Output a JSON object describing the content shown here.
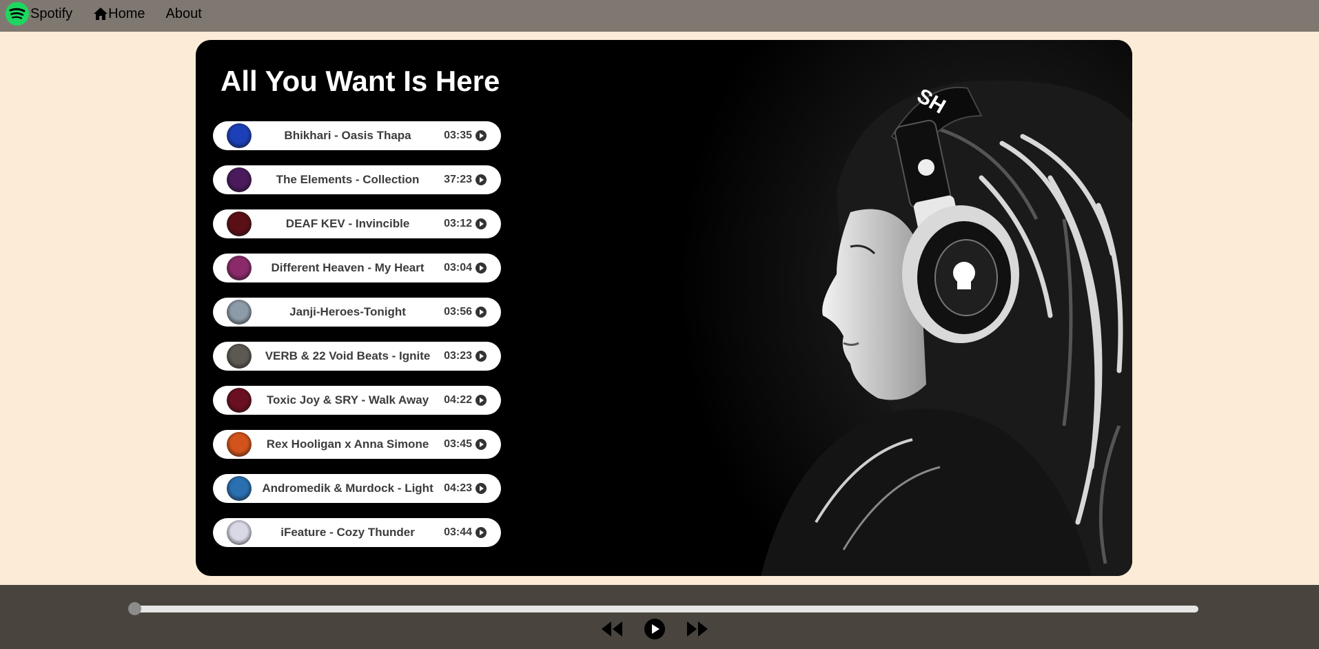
{
  "nav": {
    "brand": "Spotify",
    "home": "Home",
    "about": "About",
    "logo_icon": "spotify-logo-icon",
    "home_icon": "home-icon"
  },
  "hero": {
    "title": "All You Want Is Here",
    "image": "woman-with-headphones-photo"
  },
  "songs": [
    {
      "name": "Bhikhari - Oasis Thapa",
      "duration": "03:35",
      "cover": "#1d3fb8"
    },
    {
      "name": "The Elements - Collection",
      "duration": "37:23",
      "cover": "#4a1a5c"
    },
    {
      "name": "DEAF KEV - Invincible",
      "duration": "03:12",
      "cover": "#5a0f14"
    },
    {
      "name": "Different Heaven - My Heart",
      "duration": "03:04",
      "cover": "#8a2a6a"
    },
    {
      "name": "Janji-Heroes-Tonight",
      "duration": "03:56",
      "cover": "#8d9aa8"
    },
    {
      "name": "VERB & 22 Void Beats - Ignite",
      "duration": "03:23",
      "cover": "#5c5852"
    },
    {
      "name": "Toxic Joy & SRY - Walk Away",
      "duration": "04:22",
      "cover": "#6a1020"
    },
    {
      "name": "Rex Hooligan x Anna Simone",
      "duration": "03:45",
      "cover": "#d2531b"
    },
    {
      "name": "Andromedik & Murdock - Light",
      "duration": "04:23",
      "cover": "#2a6fb0"
    },
    {
      "name": "iFeature - Cozy Thunder",
      "duration": "03:44",
      "cover": "#d8d8e6"
    }
  ],
  "player": {
    "progress": 0,
    "prev_icon": "backward-icon",
    "play_icon": "play-circle-icon",
    "next_icon": "forward-icon"
  },
  "colors": {
    "nav_bg": "#7f7870",
    "page_bg": "#fbebd7",
    "player_bg": "#49443e",
    "spotify_green": "#1ed760"
  }
}
